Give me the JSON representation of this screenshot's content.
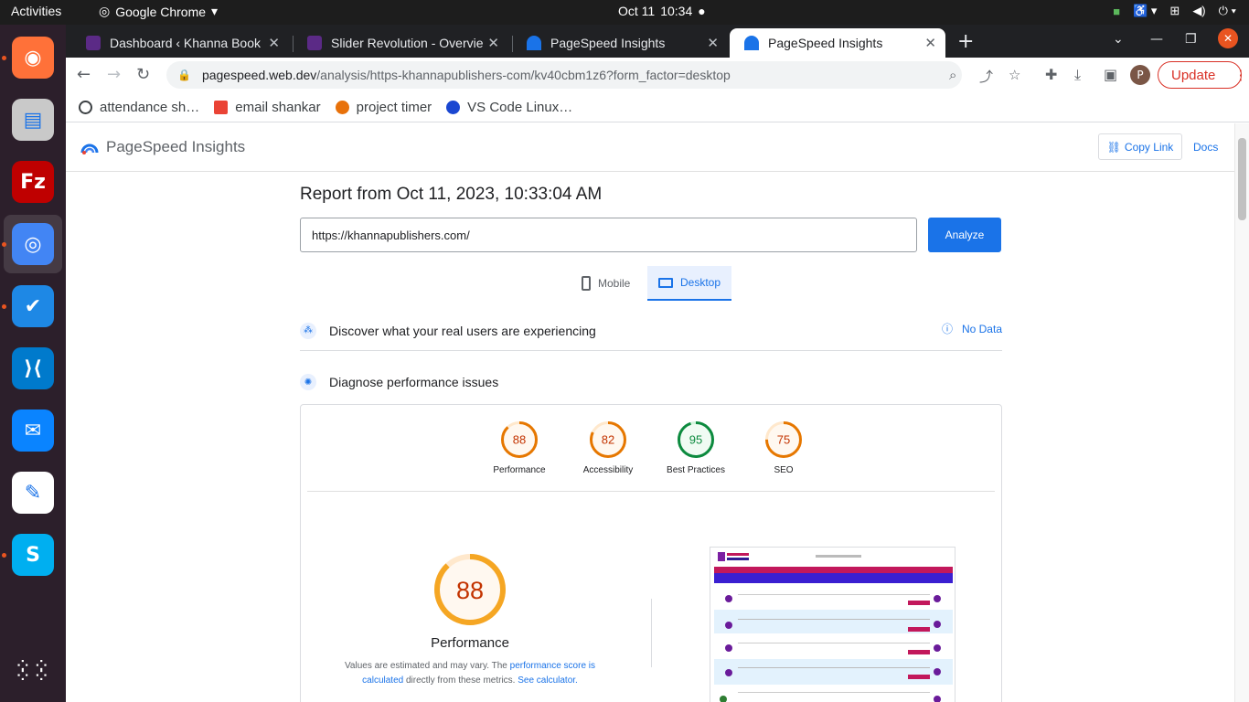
{
  "os": {
    "activities": "Activities",
    "app_name": "Google Chrome",
    "date": "Oct 11",
    "time": "10:34"
  },
  "dock": {
    "items": [
      {
        "name": "firefox",
        "color": "#ff7139"
      },
      {
        "name": "files",
        "color": "#c9c9c9"
      },
      {
        "name": "filezilla",
        "color": "#bf0000"
      },
      {
        "name": "chrome",
        "color": "#4285f4"
      },
      {
        "name": "tracker",
        "color": "#1e88e5"
      },
      {
        "name": "vscode",
        "color": "#007acc"
      },
      {
        "name": "thunderbird",
        "color": "#0a84ff"
      },
      {
        "name": "text-editor",
        "color": "#ffffff"
      },
      {
        "name": "skype",
        "color": "#00aff0"
      }
    ]
  },
  "browser": {
    "tabs": [
      {
        "title": "Dashboard ‹ Khanna Book",
        "active": false
      },
      {
        "title": "Slider Revolution - Overvie",
        "active": false
      },
      {
        "title": "PageSpeed Insights",
        "active": false
      },
      {
        "title": "PageSpeed Insights",
        "active": true
      }
    ],
    "url_host": "pagespeed.web.dev",
    "url_path": "/analysis/https-khannapublishers-com/kv40cbm1z6?form_factor=desktop",
    "avatar_letter": "P",
    "update_label": "Update",
    "bookmarks": [
      {
        "label": "attendance sh…",
        "color": "#3c4043"
      },
      {
        "label": "email shankar",
        "color": "#ea4335"
      },
      {
        "label": "project timer",
        "color": "#e8710a"
      },
      {
        "label": "VS Code Linux…",
        "color": "#1a47d1"
      }
    ]
  },
  "psi": {
    "logo": "PageSpeed Insights",
    "copy_link": "Copy Link",
    "docs": "Docs",
    "report_title": "Report from Oct 11, 2023, 10:33:04 AM",
    "url_value": "https://khannapublishers.com/",
    "analyze": "Analyze",
    "device_mobile": "Mobile",
    "device_desktop": "Desktop",
    "discover": "Discover what your real users are experiencing",
    "no_data": "No Data",
    "diagnose": "Diagnose performance issues",
    "scores": [
      {
        "label": "Performance",
        "value": 88,
        "color": "#e67700",
        "track": "#ffe8cc",
        "fill": "#fff8f0"
      },
      {
        "label": "Accessibility",
        "value": 82,
        "color": "#e67700",
        "track": "#ffe8cc",
        "fill": "#fff8f0"
      },
      {
        "label": "Best Practices",
        "value": 95,
        "color": "#0c8a3e",
        "track": "#d2f5dd",
        "fill": "#f0fbf3"
      },
      {
        "label": "SEO",
        "value": 75,
        "color": "#e67700",
        "track": "#ffe8cc",
        "fill": "#fff8f0"
      }
    ],
    "main_score": {
      "value": 88,
      "label": "Performance"
    },
    "note_prefix": "Values are estimated and may vary. The ",
    "note_link1": "performance score is calculated",
    "note_mid": " directly from these metrics. ",
    "note_link2": "See calculator."
  }
}
